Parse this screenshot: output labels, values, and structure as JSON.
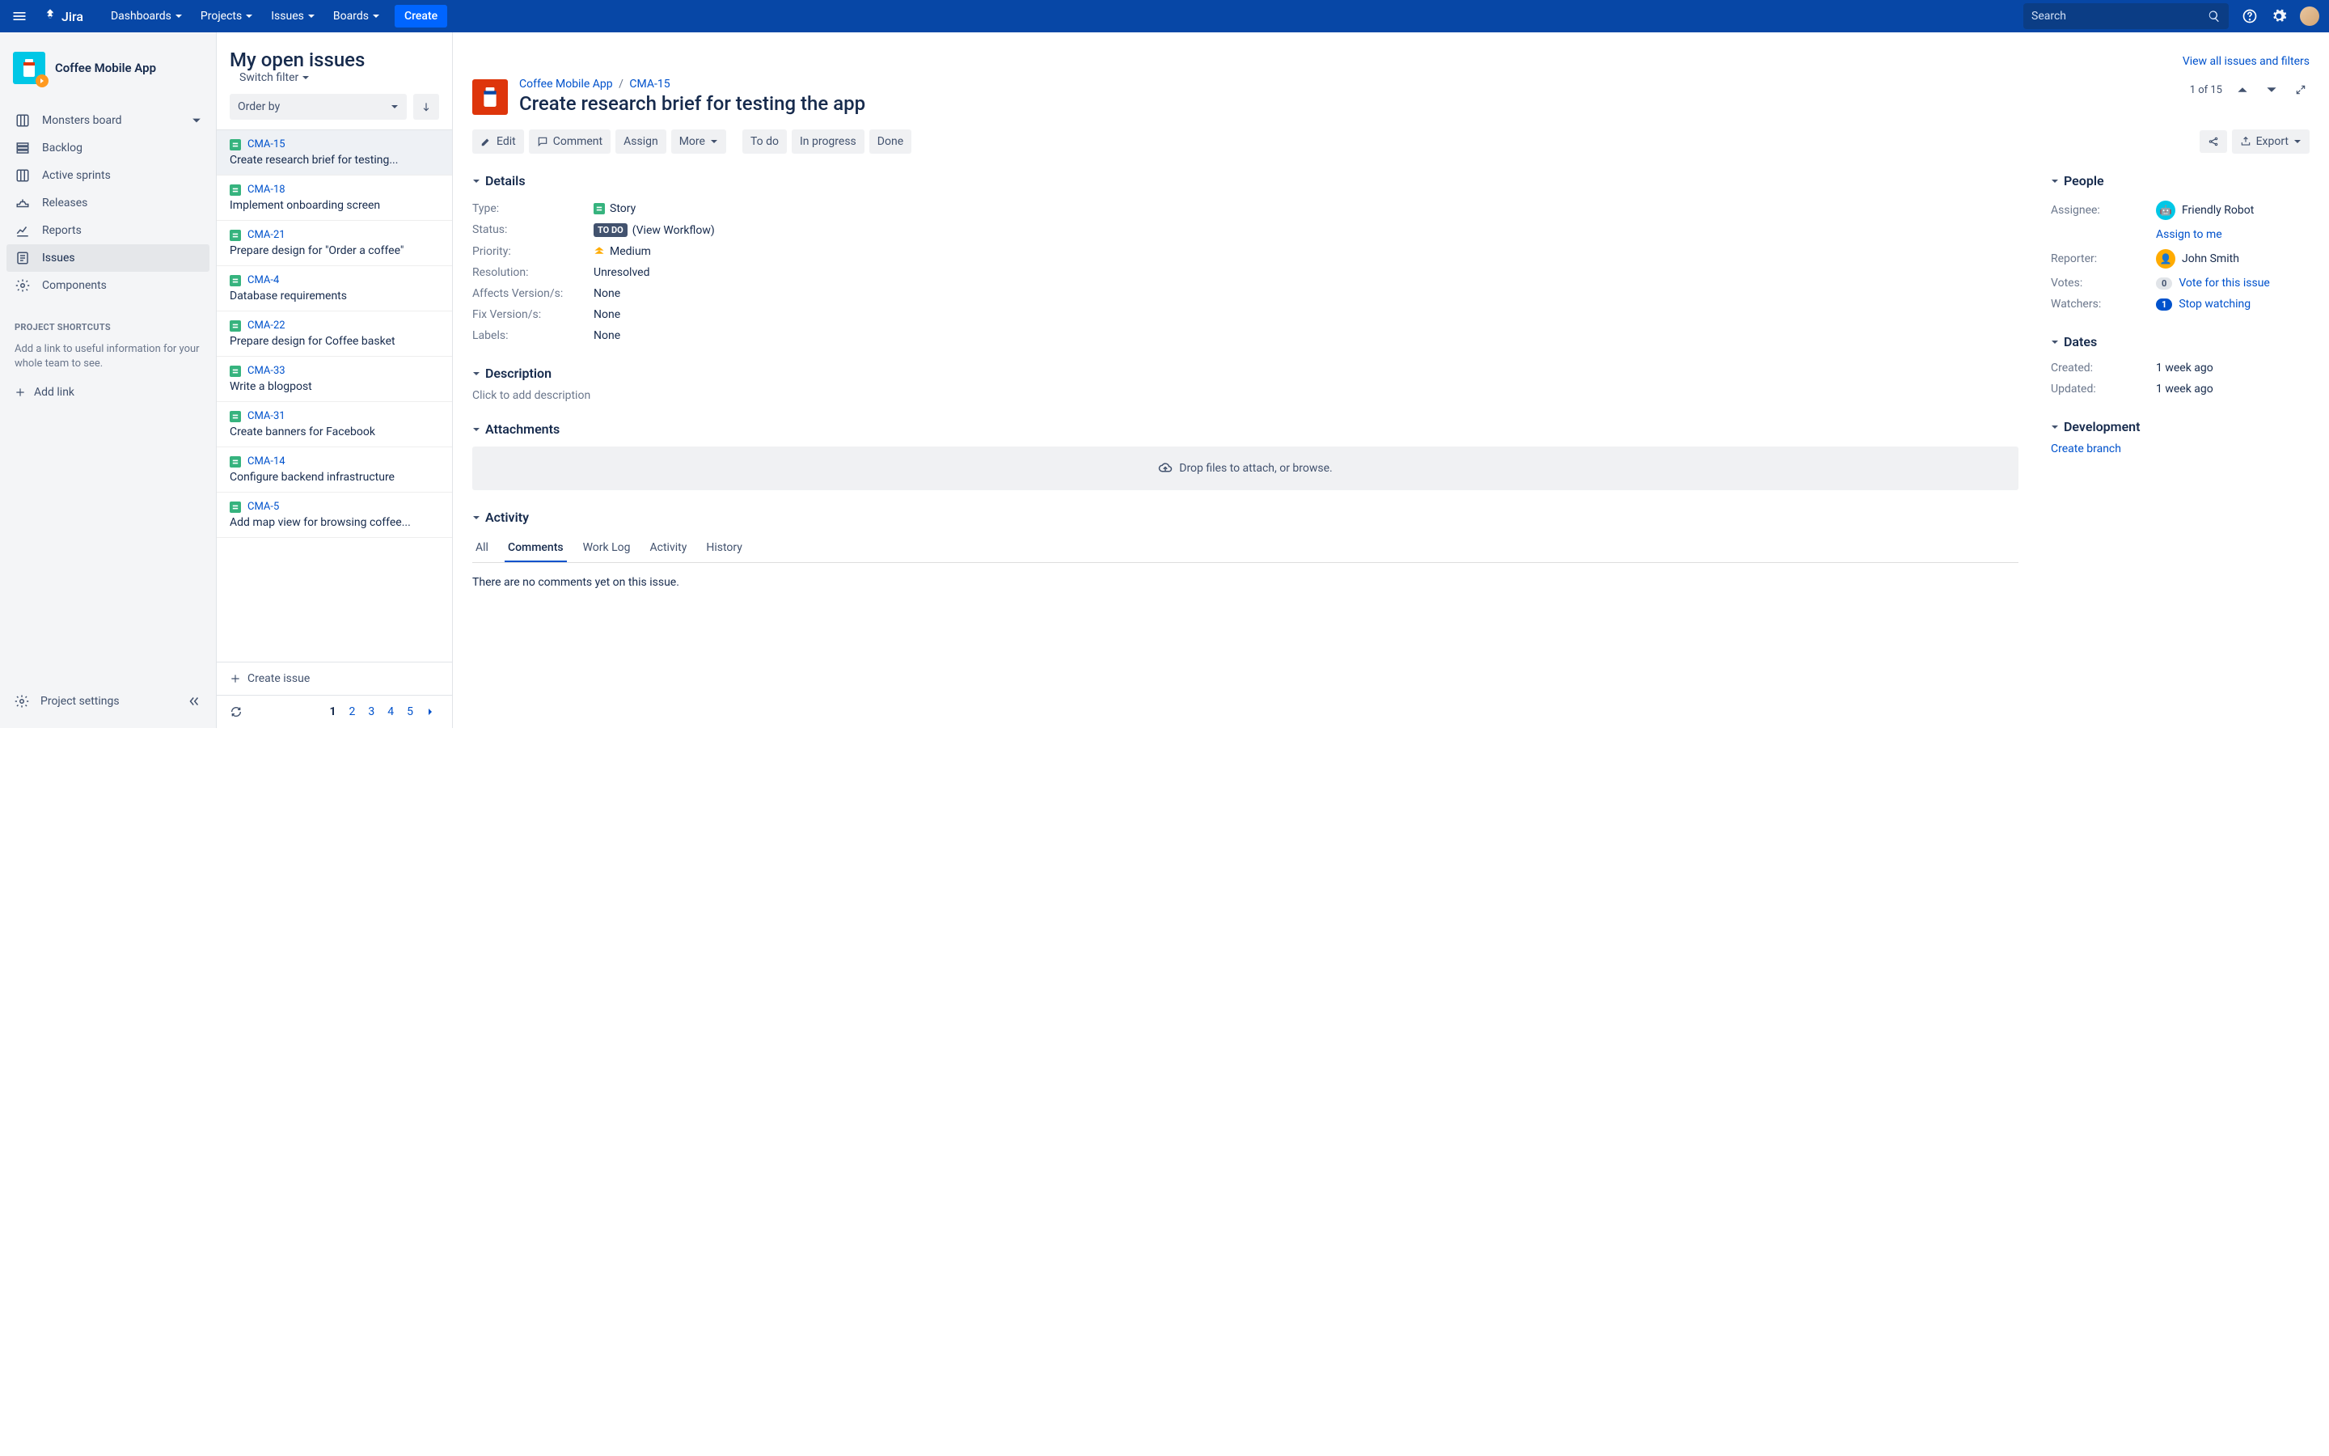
{
  "topbar": {
    "logo": "Jira",
    "nav": [
      "Dashboards",
      "Projects",
      "Issues",
      "Boards"
    ],
    "create": "Create",
    "search_placeholder": "Search"
  },
  "sidebar": {
    "project_name": "Coffee Mobile App",
    "board_item": "Monsters board",
    "items": [
      {
        "label": "Backlog"
      },
      {
        "label": "Active sprints"
      },
      {
        "label": "Releases"
      },
      {
        "label": "Reports"
      },
      {
        "label": "Issues"
      },
      {
        "label": "Components"
      }
    ],
    "shortcuts_header": "PROJECT SHORTCUTS",
    "shortcuts_text": "Add a link to useful information for your whole team to see.",
    "add_link": "Add link",
    "settings": "Project settings"
  },
  "issue_list": {
    "title": "My open issues",
    "switch_filter": "Switch filter",
    "view_all": "View all issues and filters",
    "order_by": "Order by",
    "issues": [
      {
        "key": "CMA-15",
        "summary": "Create research brief for testing..."
      },
      {
        "key": "CMA-18",
        "summary": "Implement onboarding screen"
      },
      {
        "key": "CMA-21",
        "summary": "Prepare design for \"Order a coffee\""
      },
      {
        "key": "CMA-4",
        "summary": "Database requirements"
      },
      {
        "key": "CMA-22",
        "summary": "Prepare design for Coffee basket"
      },
      {
        "key": "CMA-33",
        "summary": "Write a blogpost"
      },
      {
        "key": "CMA-31",
        "summary": "Create banners for Facebook"
      },
      {
        "key": "CMA-14",
        "summary": "Configure backend infrastructure"
      },
      {
        "key": "CMA-5",
        "summary": "Add map view for browsing coffee..."
      }
    ],
    "create_issue": "Create issue",
    "pages": [
      "1",
      "2",
      "3",
      "4",
      "5"
    ]
  },
  "detail": {
    "breadcrumb_project": "Coffee Mobile App",
    "breadcrumb_key": "CMA-15",
    "title": "Create research brief for testing the app",
    "counter": "1 of 15",
    "toolbar": {
      "edit": "Edit",
      "comment": "Comment",
      "assign": "Assign",
      "more": "More",
      "todo": "To do",
      "in_progress": "In progress",
      "done": "Done",
      "export": "Export"
    },
    "sections": {
      "details": "Details",
      "description": "Description",
      "attachments": "Attachments",
      "activity": "Activity",
      "people": "People",
      "dates": "Dates",
      "development": "Development"
    },
    "fields": {
      "type_label": "Type:",
      "type_value": "Story",
      "status_label": "Status:",
      "status_value": "TO DO",
      "status_workflow": "(View Workflow)",
      "priority_label": "Priority:",
      "priority_value": "Medium",
      "resolution_label": "Resolution:",
      "resolution_value": "Unresolved",
      "affects_label": "Affects Version/s:",
      "affects_value": "None",
      "fix_label": "Fix Version/s:",
      "fix_value": "None",
      "labels_label": "Labels:",
      "labels_value": "None"
    },
    "description_placeholder": "Click to add description",
    "dropzone": "Drop files to attach, or browse.",
    "activity_tabs": [
      "All",
      "Comments",
      "Work Log",
      "Activity",
      "History"
    ],
    "empty_comments": "There are no comments yet on this issue.",
    "people": {
      "assignee_label": "Assignee:",
      "assignee_value": "Friendly Robot",
      "assign_to_me": "Assign to me",
      "reporter_label": "Reporter:",
      "reporter_value": "John Smith",
      "votes_label": "Votes:",
      "votes_count": "0",
      "votes_link": "Vote for this issue",
      "watchers_label": "Watchers:",
      "watchers_count": "1",
      "watchers_link": "Stop watching"
    },
    "dates": {
      "created_label": "Created:",
      "created_value": "1 week ago",
      "updated_label": "Updated:",
      "updated_value": "1 week ago"
    },
    "development": {
      "create_branch": "Create branch"
    }
  }
}
